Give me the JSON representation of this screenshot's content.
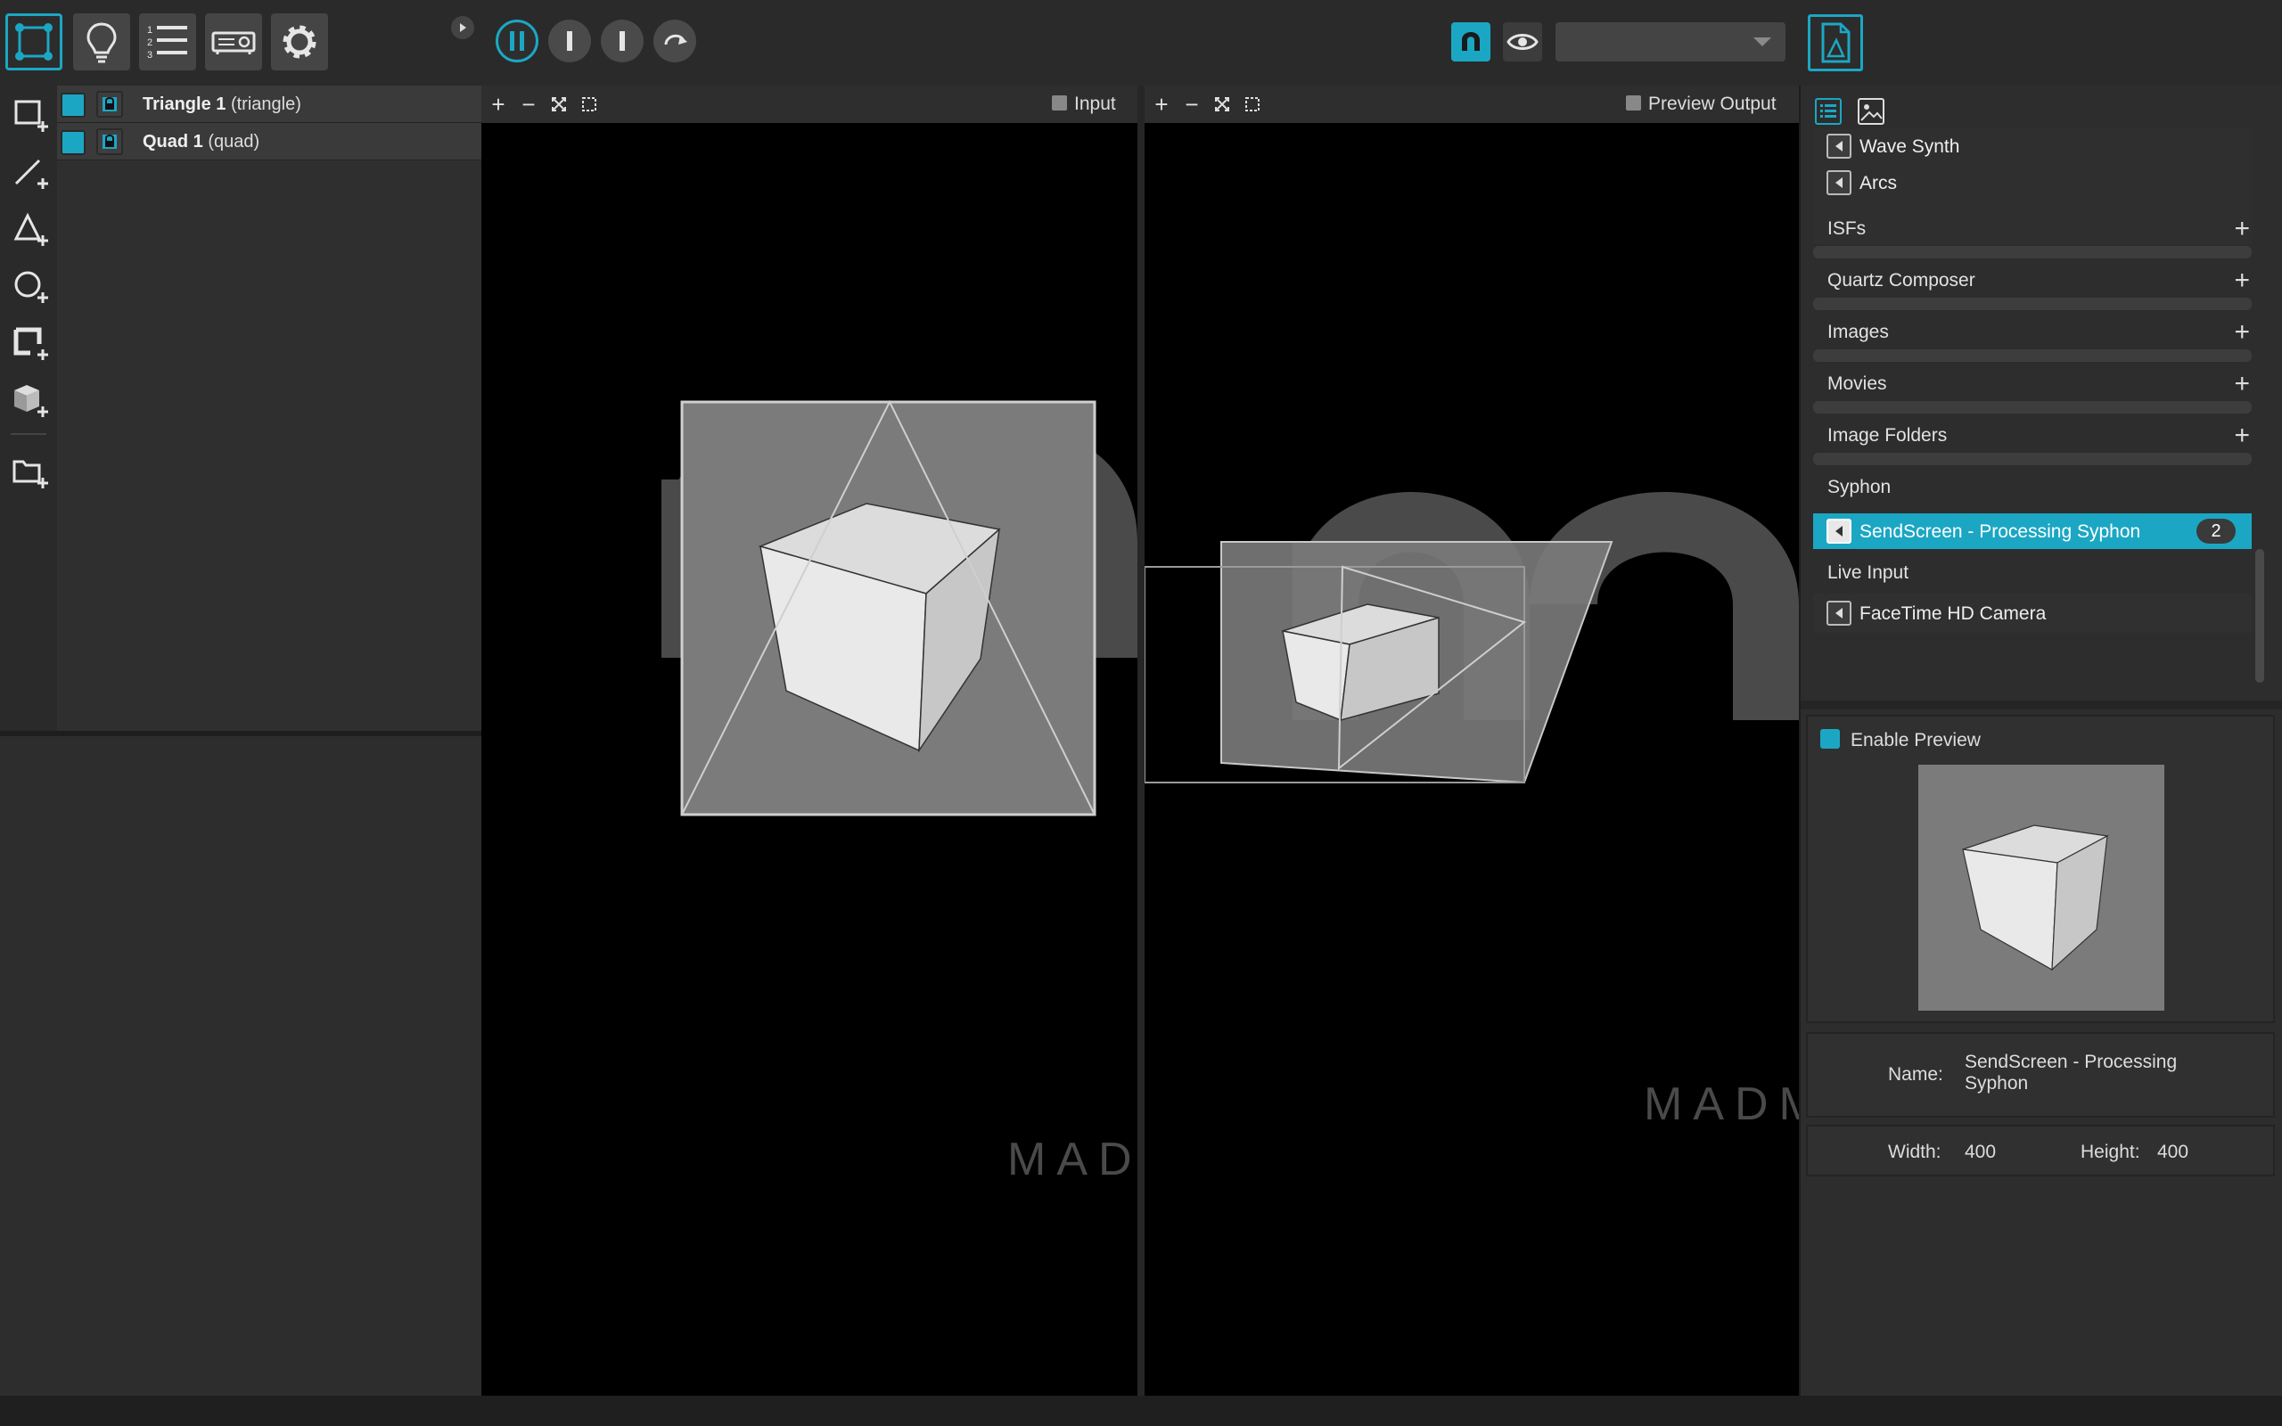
{
  "toolbar": {
    "modes": [
      {
        "icon": "mapping-mode-icon",
        "active": true
      },
      {
        "icon": "light-bulb-icon",
        "active": false
      },
      {
        "icon": "numbered-list-icon",
        "active": false
      },
      {
        "icon": "projector-icon",
        "active": false
      },
      {
        "icon": "gear-icon",
        "active": false
      }
    ],
    "numbered_list_glyph": "1\n2\n3",
    "transport": [
      "pause-icon",
      "step-icon",
      "stop-icon",
      "rewind-icon"
    ],
    "display_select_value": "",
    "accent_color": "#1ba7c4"
  },
  "tools": [
    "add-quad-icon",
    "add-line-icon",
    "add-triangle-icon",
    "add-circle-icon",
    "add-mesh-icon",
    "add-3d-object-icon",
    "add-folder-icon"
  ],
  "layers": [
    {
      "name": "Triangle 1",
      "type": "(triangle)",
      "visible": true,
      "locked": true
    },
    {
      "name": "Quad 1",
      "type": "(quad)",
      "visible": true,
      "locked": true
    }
  ],
  "input_view": {
    "title": "Input"
  },
  "output_view": {
    "title": "Preview Output"
  },
  "watermark": {
    "text": "MADM",
    "letters": "MAD"
  },
  "sources": {
    "top_items": [
      "Wave Synth",
      "Arcs"
    ],
    "categories": [
      {
        "name": "ISFs",
        "addable": true
      },
      {
        "name": "Quartz Composer",
        "addable": true
      },
      {
        "name": "Images",
        "addable": true
      },
      {
        "name": "Movies",
        "addable": true
      },
      {
        "name": "Image Folders",
        "addable": true
      }
    ],
    "syphon": {
      "name": "Syphon",
      "items": [
        {
          "label": "SendScreen - Processing Syphon",
          "count": "2",
          "selected": true
        }
      ]
    },
    "live_input": {
      "name": "Live Input",
      "items": [
        {
          "label": "FaceTime HD Camera"
        }
      ]
    }
  },
  "preview": {
    "enable_label": "Enable Preview",
    "enabled": true
  },
  "info": {
    "name_label": "Name:",
    "name_value": "SendScreen - Processing Syphon",
    "width_label": "Width:",
    "width_value": "400",
    "height_label": "Height:",
    "height_value": "400"
  }
}
